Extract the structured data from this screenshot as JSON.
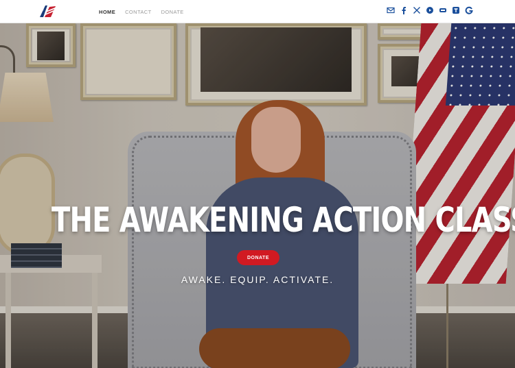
{
  "nav": {
    "items": [
      {
        "label": "HOME"
      },
      {
        "label": "CONTACT"
      },
      {
        "label": "DONATE"
      }
    ]
  },
  "social_icons": [
    "email-icon",
    "facebook-icon",
    "x-twitter-icon",
    "rumble-icon",
    "truth-social-icon",
    "telegram-icon",
    "gettr-icon"
  ],
  "hero": {
    "title": "THE AWAKENING ACTION CLASS",
    "donate_label": "DONATE",
    "tagline": "AWAKE. EQUIP. ACTIVATE."
  },
  "colors": {
    "accent_red": "#d11a22",
    "social_blue": "#1a4f9c",
    "nav_active": "#333333",
    "nav_inactive": "#9a9a9a"
  }
}
